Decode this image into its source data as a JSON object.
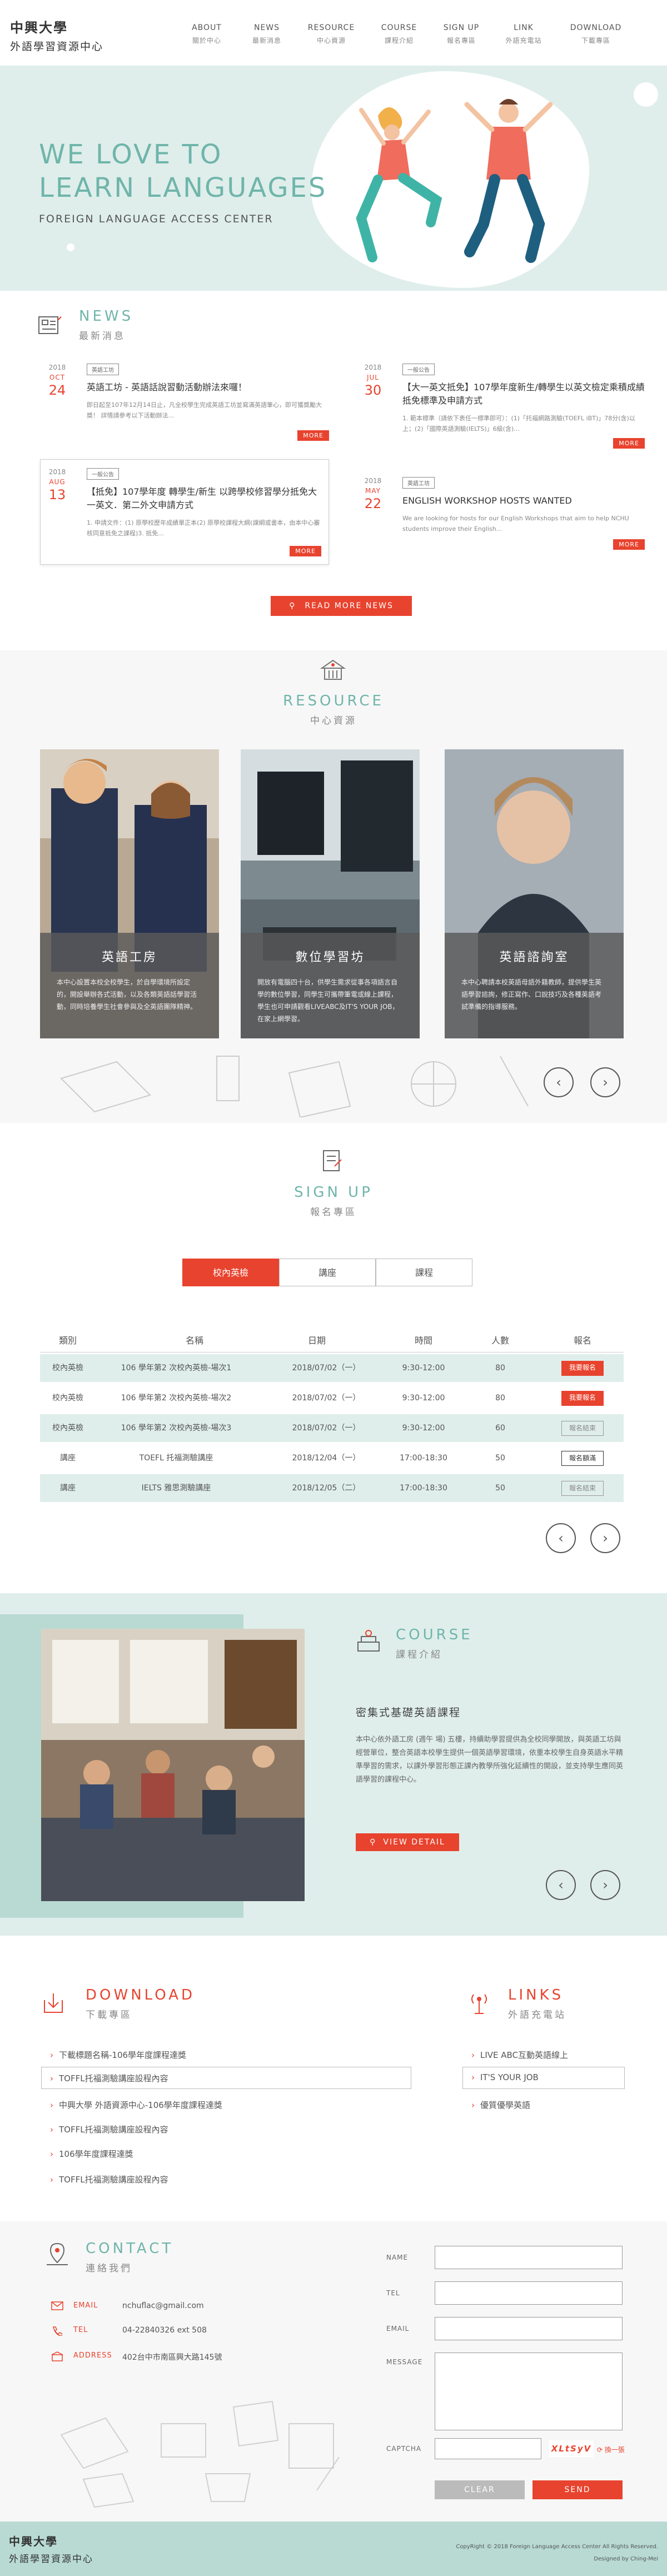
{
  "header": {
    "logo_line1": "中興大學",
    "logo_line2": "外語學習資源中心",
    "nav": [
      {
        "en": "ABOUT",
        "zh": "關於中心"
      },
      {
        "en": "NEWS",
        "zh": "最新消息"
      },
      {
        "en": "RESOURCE",
        "zh": "中心資源"
      },
      {
        "en": "COURSE",
        "zh": "課程介紹"
      },
      {
        "en": "SIGN UP",
        "zh": "報名專區"
      },
      {
        "en": "LINK",
        "zh": "外語充電站"
      },
      {
        "en": "DOWNLOAD",
        "zh": "下載專區"
      }
    ]
  },
  "hero": {
    "title_line1": "WE LOVE TO",
    "title_line2": "LEARN LANGUAGES",
    "subtitle": "FOREIGN LANGUAGE ACCESS CENTER"
  },
  "news": {
    "title_en": "NEWS",
    "title_zh": "最新消息",
    "more_label": "MORE",
    "read_more": "READ MORE NEWS",
    "items": [
      {
        "year": "2018",
        "month": "OCT",
        "day": "24",
        "tag": "英語工坊",
        "title": "英語工坊 - 英語話說習動活動辦法來囉！",
        "desc": "即日起至107年12月14日止，凡全校學生完成英語工坊並寫滿英語筆心，即可獲獎勵大獎！ 詳情請參考以下活動辦法..."
      },
      {
        "year": "2018",
        "month": "JUL",
        "day": "30",
        "tag": "一般公告",
        "title": "【大一英文抵免】107學年度新生/轉學生以英文檢定乘積成績抵免標準及申請方式",
        "desc": "1. 範本標準（請依下表任一標準即可）：(1)「托福網路測驗(TOEFL iBT)」78分(含)以上；(2)「國際英語測驗(IELTS)」6級(含)..."
      },
      {
        "year": "2018",
        "month": "AUG",
        "day": "13",
        "tag": "一般公告",
        "title": "【抵免】107學年度 轉學生/新生 以跨學校修習學分抵免大一英文．第二外文申請方式",
        "desc": "1. 申請文件：(1) 原學校歷年成績單正本(2) 原學校課程大綱(課綱或書本，由本中心審核同意抵免之課程)3. 抵免..."
      },
      {
        "year": "2018",
        "month": "MAY",
        "day": "22",
        "tag": "英語工坊",
        "title": "ENGLISH WORKSHOP HOSTS WANTED",
        "desc": "We are looking for hosts for our English Workshops that aim to help NCHU students improve their English..."
      }
    ]
  },
  "resource": {
    "title_en": "RESOURCE",
    "title_zh": "中心資源",
    "cards": [
      {
        "title": "英語工房",
        "desc": "本中心設置本校全校學生，於自學環境所設定的，開設舉辦各式活動，以及各類英語話學習活動，同時培養學生社會參與及全英語團隊精神。"
      },
      {
        "title": "數位學習坊",
        "desc": "開放有電腦四十台，供學生需求從事各項語言自學的數位學習，同學生可攜帶筆電或線上課程，學生也可申請觀看LIVEABC及IT'S YOUR JOB，在家上網學習。"
      },
      {
        "title": "英語諮詢室",
        "desc": "本中心聘請本校英語母語外籍教師，提供學生英語學習諮詢，修正寫作、口說技巧及各種英語考試準備的指導服務。"
      }
    ]
  },
  "signup": {
    "title_en": "SIGN UP",
    "title_zh": "報名專區",
    "tabs": [
      "校內英檢",
      "講座",
      "課程"
    ],
    "columns": [
      "類別",
      "名稱",
      "日期",
      "時間",
      "人數",
      "報名"
    ],
    "rows": [
      {
        "cat": "校內英檢",
        "name": "106 學年第2 次校內英檢-場次1",
        "date": "2018/07/02（一）",
        "time": "9:30-12:00",
        "count": "80",
        "action": "我要報名",
        "status": "open"
      },
      {
        "cat": "校內英檢",
        "name": "106 學年第2 次校內英檢-場次2",
        "date": "2018/07/02（一）",
        "time": "9:30-12:00",
        "count": "80",
        "action": "我要報名",
        "status": "open"
      },
      {
        "cat": "校內英檢",
        "name": "106 學年第2 次校內英檢-場次3",
        "date": "2018/07/02（一）",
        "time": "9:30-12:00",
        "count": "60",
        "action": "報名結束",
        "status": "closed"
      },
      {
        "cat": "講座",
        "name": "TOEFL 托福測驗講座",
        "date": "2018/12/04（一）",
        "time": "17:00-18:30",
        "count": "50",
        "action": "報名額滿",
        "status": "full"
      },
      {
        "cat": "講座",
        "name": "IELTS 雅思測驗講座",
        "date": "2018/12/05（二）",
        "time": "17:00-18:30",
        "count": "50",
        "action": "報名結束",
        "status": "closed"
      }
    ]
  },
  "course": {
    "title_en": "COURSE",
    "title_zh": "課程介紹",
    "heading": "密集式基礎英語課程",
    "desc": "本中心依外語工房 (週午 場) 五樓，持續助學習提供為全校同學開放，與英語工坊與經營單位，整合英語本校學生提供一個英語學習環境，依重本校學生自身英語水平精準學習的需求，以課外學習形態正課內教學所強化延續性的開設，並支持學生應同英語學習的課程中心。",
    "button": "VIEW DETAIL"
  },
  "download": {
    "title_en": "DOWNLOAD",
    "title_zh": "下載專區",
    "items": [
      "下載標題名稱-106學年度課程達獎",
      "TOFFL托福測驗講座設程內容",
      "中興大學 外語資源中心-106學年度課程達獎",
      "TOFFL托福測驗講座設程內容",
      "106學年度課程達獎",
      "TOFFL托福測驗講座設程內容"
    ]
  },
  "links": {
    "title_en": "LINKS",
    "title_zh": "外語充電站",
    "items": [
      "LIVE ABC互動英語線上",
      "IT'S YOUR JOB",
      "優質優學英語"
    ]
  },
  "contact": {
    "title_en": "CONTACT",
    "title_zh": "連絡我們",
    "email_label": "EMAIL",
    "email": "nchuflac@gmail.com",
    "tel_label": "TEL",
    "tel": "04-22840326 ext 508",
    "address_label": "ADDRESS",
    "address": "402台中市南區興大路145號",
    "form": {
      "name": "NAME",
      "tel": "TEL",
      "email": "EMAIL",
      "message": "MESSAGE",
      "captcha": "CAPTCHA",
      "captcha_code": "XLtSyV",
      "refresh": "換一張",
      "clear": "CLEAR",
      "send": "SEND"
    }
  },
  "footer": {
    "logo_line1": "中興大學",
    "logo_line2": "外語學習資源中心",
    "copyright": "CopyRight © 2018 Foreign Language Access Center All Rights Reserved.",
    "designer": "Designed by Ching-Mei"
  },
  "colors": {
    "accent": "#e8432e",
    "teal": "#6fb5aa",
    "teal_bg": "#dfeeeb"
  }
}
